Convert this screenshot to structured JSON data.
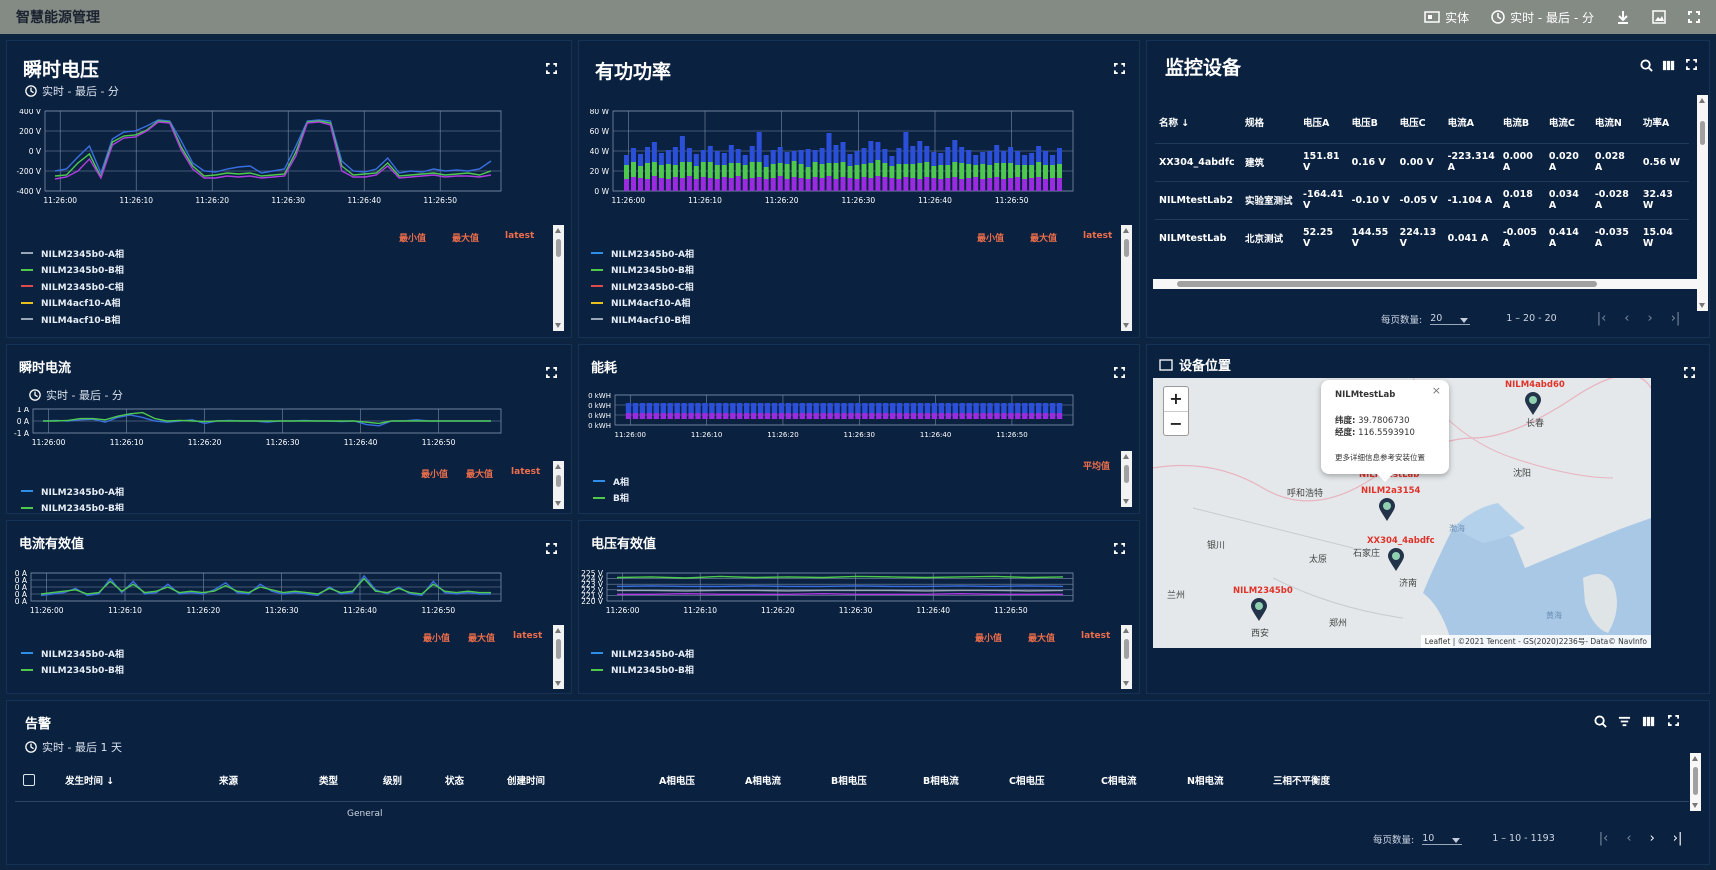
{
  "topbar": {
    "title": "智慧能源管理",
    "entity": "实体",
    "realtime": "实时 - 最后 - 分"
  },
  "voltage": {
    "title": "瞬时电压",
    "subtitle": "实时 - 最后 - 分",
    "legend_head": [
      "最小值",
      "最大值",
      "latest"
    ],
    "legend": [
      "NILM2345b0-A相",
      "NILM2345b0-B相",
      "NILM2345b0-C相",
      "NILM4acf10-A相",
      "NILM4acf10-B相"
    ],
    "legend_colors": [
      "#9aa7b8",
      "#4ec94e",
      "#e04a4a",
      "#e8c21c",
      "#9aa7b8"
    ]
  },
  "power": {
    "title": "有功功率",
    "legend_head": [
      "最小值",
      "最大值",
      "latest"
    ],
    "legend": [
      "NILM2345b0-A相",
      "NILM2345b0-B相",
      "NILM2345b0-C相",
      "NILM4acf10-A相",
      "NILM4acf10-B相"
    ],
    "legend_colors": [
      "#2f8fe8",
      "#4ec94e",
      "#e04a4a",
      "#e8c21c",
      "#9aa7b8"
    ]
  },
  "current": {
    "title": "瞬时电流",
    "subtitle": "实时 - 最后 - 分",
    "legend_head": [
      "最小值",
      "最大值",
      "latest"
    ],
    "legend": [
      "NILM2345b0-A相",
      "NILM2345b0-B相"
    ],
    "legend_colors": [
      "#2f8fe8",
      "#4ec94e"
    ]
  },
  "energy": {
    "title": "能耗",
    "legend_head": [
      "平均值"
    ],
    "legend": [
      "A相",
      "B相"
    ],
    "legend_colors": [
      "#2f8fe8",
      "#4ec94e"
    ]
  },
  "irms": {
    "title": "电流有效值",
    "legend_head": [
      "最小值",
      "最大值",
      "latest"
    ],
    "legend": [
      "NILM2345b0-A相",
      "NILM2345b0-B相"
    ],
    "legend_colors": [
      "#2f8fe8",
      "#4ec94e"
    ]
  },
  "vrms": {
    "title": "电压有效值",
    "legend_head": [
      "最小值",
      "最大值",
      "latest"
    ],
    "legend": [
      "NILM2345b0-A相",
      "NILM2345b0-B相"
    ],
    "legend_colors": [
      "#2f8fe8",
      "#4ec94e"
    ]
  },
  "devices": {
    "title": "监控设备",
    "columns": [
      "名称 ↓",
      "规格",
      "电压A",
      "电压B",
      "电压C",
      "电流A",
      "电流B",
      "电流C",
      "电流N",
      "功率A"
    ],
    "rows": [
      [
        "XX304_4abdfc",
        "建筑",
        "151.81 V",
        "0.16 V",
        "0.00 V",
        "-223.314 A",
        "0.000 A",
        "0.020 A",
        "0.028 A",
        "0.56 W"
      ],
      [
        "NILMtestLab2",
        "实验室测试",
        "-164.41 V",
        "-0.10 V",
        "-0.05 V",
        "-1.104 A",
        "0.018 A",
        "0.034 A",
        "-0.028 A",
        "32.43 W"
      ],
      [
        "NILMtestLab",
        "北京测试",
        "52.25 V",
        "144.55 V",
        "224.13 V",
        "0.041 A",
        "-0.005 A",
        "0.414 A",
        "-0.035 A",
        "15.04 W"
      ]
    ],
    "page_size_label": "每页数量:",
    "page_size": "20",
    "range": "1 – 20 - 20"
  },
  "map": {
    "title": "设备位置",
    "popup": {
      "name": "NILMtestLab",
      "lat_label": "纬度:",
      "lat": "39.7806730",
      "lon_label": "经度:",
      "lon": "116.5593910",
      "more": "更多详细信息参考安装位置"
    },
    "pins": [
      "NILM4abd60",
      "NILMtestLab",
      "NILM2a3154",
      "XX304_4abdfc",
      "NILM2345b0"
    ],
    "cities": [
      "长春",
      "沈阳",
      "呼和浩特",
      "石家庄",
      "太原",
      "银川",
      "济南",
      "兰州",
      "郑州",
      "西安",
      "渤海",
      "黄海"
    ],
    "attribution": "Leaflet | ©2021 Tencent - GS(2020)2236号- Data© NavInfo"
  },
  "alarm": {
    "title": "告警",
    "subtitle": "实时 - 最后 1 天",
    "columns": [
      "发生时间 ↓",
      "来源",
      "类型",
      "级别",
      "状态",
      "创建时间",
      "A相电压",
      "A相电流",
      "B相电压",
      "B相电流",
      "C相电压",
      "C相电流",
      "N相电流",
      "三相不平衡度"
    ],
    "partial_cell": "General",
    "page_size_label": "每页数量:",
    "page_size": "10",
    "range": "1 – 10 - 1193"
  },
  "chart_data": [
    {
      "type": "line",
      "title": "瞬时电压",
      "x": [
        "11:26:00",
        "11:26:10",
        "11:26:20",
        "11:26:30",
        "11:26:40",
        "11:26:50"
      ],
      "ylim": [
        -400,
        400
      ],
      "yticks": [
        "400 V",
        "200 V",
        "0 V",
        "-200 V",
        "-400 V"
      ],
      "series": [
        {
          "name": "NILM2345b0-A相",
          "color": "#3a6fe0",
          "values": [
            -200,
            -180,
            -60,
            50,
            -220,
            120,
            190,
            200,
            250,
            310,
            300,
            100,
            -120,
            -200,
            -210,
            -180,
            -160,
            -150,
            -220,
            -200,
            -180,
            50,
            300,
            310,
            300,
            -100,
            -200,
            -210,
            -180,
            -70,
            -220,
            -200,
            -210,
            -180,
            -200,
            -190,
            -200,
            -180,
            -100
          ]
        },
        {
          "name": "NILM2345b0-B相",
          "color": "#4ec94e",
          "values": [
            -250,
            -240,
            -120,
            -30,
            -260,
            90,
            150,
            160,
            210,
            300,
            290,
            40,
            -150,
            -250,
            -240,
            -220,
            -230,
            -220,
            -250,
            -240,
            -230,
            -10,
            290,
            300,
            280,
            -150,
            -240,
            -230,
            -220,
            -120,
            -250,
            -240,
            -230,
            -220,
            -240,
            -230,
            -220,
            -240,
            -200
          ]
        },
        {
          "name": "NILM4acf10-A相",
          "color": "#b03de0",
          "values": [
            -280,
            -260,
            -200,
            -80,
            -270,
            60,
            130,
            140,
            200,
            290,
            280,
            10,
            -180,
            -270,
            -270,
            -250,
            -260,
            -250,
            -270,
            -260,
            -250,
            -50,
            280,
            290,
            260,
            -200,
            -260,
            -260,
            -240,
            -150,
            -270,
            -260,
            -250,
            -240,
            -260,
            -250,
            -250,
            -260,
            -240
          ]
        }
      ]
    },
    {
      "type": "bar",
      "title": "有功功率",
      "x": [
        "11:26:00",
        "11:26:10",
        "11:26:20",
        "11:26:30",
        "11:26:40",
        "11:26:50"
      ],
      "ylim": [
        0,
        80
      ],
      "yticks": [
        "80 W",
        "60 W",
        "40 W",
        "20 W",
        "0 W"
      ],
      "series": [
        {
          "name": "NILM2345b0-C相",
          "color": "#9b2be0",
          "values": [
            12,
            14,
            13,
            12,
            15,
            13,
            12,
            14,
            13,
            15,
            12,
            14,
            13,
            12,
            14,
            13,
            15,
            12,
            13,
            14,
            12,
            13,
            15,
            12,
            14,
            13,
            12,
            14,
            13,
            15,
            12,
            14,
            13,
            12,
            14,
            13,
            15,
            14,
            13,
            12,
            14,
            13,
            12,
            14,
            13,
            12,
            13,
            14,
            12,
            13,
            14,
            12,
            13,
            14,
            12,
            13,
            14,
            12,
            13,
            14,
            12,
            13,
            13
          ]
        },
        {
          "name": "NILM2345b0-B相",
          "color": "#4ec94e",
          "values": [
            14,
            15,
            12,
            16,
            14,
            13,
            15,
            12,
            16,
            14,
            13,
            15,
            16,
            14,
            12,
            15,
            13,
            14,
            16,
            15,
            12,
            14,
            13,
            15,
            16,
            14,
            12,
            15,
            14,
            13,
            16,
            15,
            12,
            14,
            13,
            15,
            16,
            14,
            12,
            15,
            13,
            14,
            16,
            15,
            12,
            14,
            13,
            15,
            16,
            14,
            12,
            15,
            13,
            14,
            16,
            15,
            12,
            14,
            13,
            15,
            14,
            13,
            14
          ]
        },
        {
          "name": "NILM2345b0-A相",
          "color": "#2b4fd8",
          "values": [
            10,
            14,
            12,
            16,
            20,
            12,
            14,
            18,
            26,
            14,
            12,
            12,
            16,
            14,
            12,
            18,
            14,
            10,
            16,
            30,
            12,
            14,
            16,
            12,
            10,
            14,
            18,
            12,
            16,
            30,
            18,
            20,
            12,
            14,
            16,
            22,
            18,
            14,
            10,
            16,
            32,
            18,
            22,
            16,
            14,
            12,
            18,
            22,
            16,
            14,
            10,
            12,
            14,
            18,
            12,
            16,
            14,
            10,
            12,
            16,
            14,
            10,
            16
          ]
        }
      ]
    },
    {
      "type": "line",
      "title": "瞬时电流",
      "x": [
        "11:26:00",
        "11:26:10",
        "11:26:20",
        "11:26:30",
        "11:26:40",
        "11:26:50"
      ],
      "yticks": [
        "1 A",
        "0 A",
        "-1 A"
      ],
      "series": [
        {
          "name": "NILM2345b0-A相",
          "color": "#3a6fe0",
          "values": [
            0,
            0.05,
            0,
            0.1,
            0.15,
            -0.1,
            0.3,
            0.5,
            0.3,
            0,
            -0.1,
            0,
            0.1,
            -0.2,
            0,
            0.05,
            0,
            0,
            -0.1,
            0,
            0,
            0.05,
            0,
            0,
            -0.05,
            0,
            -0.3,
            -0.4,
            0,
            0,
            0.1,
            0,
            0,
            0,
            0,
            0,
            0
          ]
        },
        {
          "name": "NILM2345b0-B相",
          "color": "#4ec94e",
          "values": [
            0,
            0,
            0.05,
            0.2,
            0.2,
            0.1,
            0.4,
            0.6,
            0.7,
            0.2,
            0,
            0.05,
            0,
            -0.05,
            0,
            0,
            0,
            0,
            0,
            0,
            0,
            0,
            0,
            0,
            0,
            0,
            -0.1,
            -0.2,
            0,
            0,
            0,
            0,
            0,
            0,
            0,
            0,
            0
          ]
        }
      ]
    },
    {
      "type": "bar",
      "title": "能耗",
      "x": [
        "11:26:00",
        "11:26:10",
        "11:26:20",
        "11:26:30",
        "11:26:40",
        "11:26:50"
      ],
      "yticks": [
        "0 kWH",
        "0 kWH",
        "0 kWH",
        "0 kWH"
      ],
      "series": [
        {
          "name": "A相",
          "color": "#2b4fd8",
          "values": [
            1
          ]
        },
        {
          "name": "B相",
          "color": "#4ec94e",
          "values": [
            1
          ]
        }
      ]
    },
    {
      "type": "line",
      "title": "电流有效值",
      "x": [
        "11:26:00",
        "11:26:10",
        "11:26:20",
        "11:26:30",
        "11:26:40",
        "11:26:50"
      ],
      "yticks": [
        "0 A",
        "0 A",
        "0 A",
        "0 A",
        "0 A"
      ],
      "series": [
        {
          "name": "NILM2345b0-A相",
          "color": "#3a6fe0",
          "values": [
            0.4,
            0.5,
            0.6,
            0.9,
            0.4,
            0.5,
            1.6,
            0.6,
            1.4,
            0.5,
            0.6,
            1.2,
            0.5,
            0.6,
            0.5,
            0.8,
            1.3,
            0.6,
            0.5,
            1.2,
            0.7,
            0.5,
            0.6,
            0.5,
            0.4,
            1.0,
            0.5,
            0.6,
            1.8,
            0.8,
            0.5,
            1.0,
            0.5,
            0.4,
            1.4,
            0.6,
            0.5,
            0.6,
            0.5,
            0.5
          ]
        },
        {
          "name": "NILM2345b0-B相",
          "color": "#4ec94e",
          "values": [
            0.5,
            0.6,
            0.7,
            0.8,
            0.5,
            0.6,
            1.4,
            0.7,
            1.2,
            0.6,
            0.7,
            1.0,
            0.6,
            0.7,
            0.6,
            0.7,
            1.1,
            0.7,
            0.6,
            1.0,
            0.8,
            0.6,
            0.7,
            0.6,
            0.5,
            0.9,
            0.6,
            0.7,
            1.6,
            0.7,
            0.6,
            0.9,
            0.6,
            0.5,
            1.2,
            0.7,
            0.6,
            0.7,
            0.6,
            0.6
          ]
        }
      ]
    },
    {
      "type": "line",
      "title": "电压有效值",
      "x": [
        "11:26:00",
        "11:26:10",
        "11:26:20",
        "11:26:30",
        "11:26:40",
        "11:26:50"
      ],
      "ylim": [
        220,
        225
      ],
      "yticks": [
        "225 V",
        "224 V",
        "223 V",
        "222 V",
        "221 V",
        "220 V"
      ],
      "series": [
        {
          "name": "NILM2345b0-A相",
          "color": "#4ec94e",
          "values": [
            224.2,
            224.3,
            224.1,
            224.4,
            224.2,
            224.3,
            224.2,
            224.4,
            224.3,
            224.2,
            224.3,
            224.4,
            224.2,
            224.3
          ]
        },
        {
          "name": "NILM2345b0-B相",
          "color": "#3a6fe0",
          "values": [
            222.6,
            222.7,
            222.6,
            222.6,
            222.7,
            222.6,
            222.6,
            222.7,
            222.6,
            222.6,
            222.7,
            222.6,
            222.7,
            222.6
          ]
        },
        {
          "name": "NILM2345b0-C相",
          "color": "#9aa7b8",
          "values": [
            221.9,
            221.9,
            221.8,
            221.9,
            221.9,
            221.8,
            221.9,
            221.9,
            221.9,
            221.8,
            221.9,
            221.9,
            221.8,
            221.9
          ]
        },
        {
          "name": "NILM4acf10-A相",
          "color": "#b03de0",
          "values": [
            221.2,
            221.2,
            221.3,
            221.2,
            221.2,
            221.2,
            221.3,
            221.2,
            221.2,
            221.2,
            221.3,
            221.2,
            221.2,
            221.2
          ]
        }
      ]
    }
  ]
}
